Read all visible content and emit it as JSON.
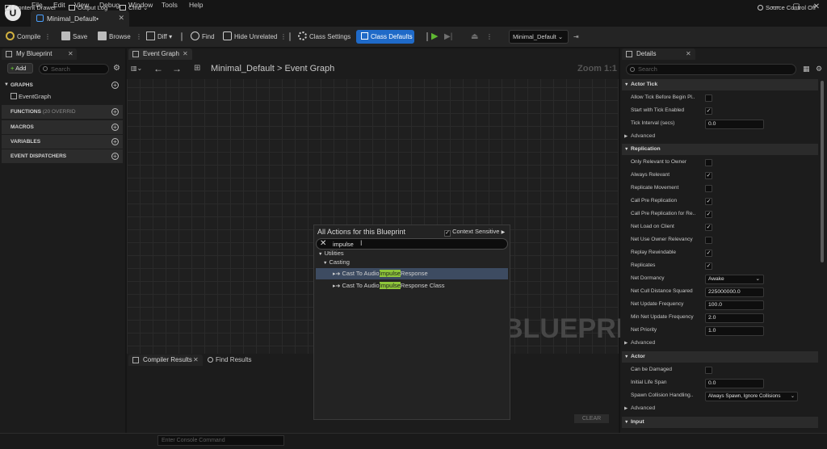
{
  "menu": [
    "File",
    "Edit",
    "View",
    "Debug",
    "Window",
    "Tools",
    "Help"
  ],
  "doc_tab": {
    "label": "Minimal_Default•"
  },
  "toolbar": {
    "compile": "Compile",
    "save": "Save",
    "browse": "Browse",
    "diff": "Diff",
    "find": "Find",
    "hide_unrelated": "Hide Unrelated",
    "class_settings": "Class Settings",
    "class_defaults": "Class Defaults",
    "debug_object": "Minimal_Default"
  },
  "my_blueprint": {
    "tab": "My Blueprint",
    "add": "Add",
    "search_placeholder": "Search",
    "graphs": "GRAPHS",
    "event_graph": "EventGraph",
    "functions": "FUNCTIONS",
    "functions_count": "(20 OVERRID",
    "macros": "MACROS",
    "variables": "VARIABLES",
    "dispatchers": "EVENT DISPATCHERS"
  },
  "graph": {
    "tab": "Event Graph",
    "breadcrumb_root": "Minimal_Default",
    "breadcrumb_sep": ">",
    "breadcrumb_leaf": "Event Graph",
    "zoom": "Zoom 1:1",
    "watermark": "BLUEPRINT"
  },
  "bottom": {
    "compiler_results": "Compiler Results",
    "find_results": "Find Results",
    "clear": "CLEAR"
  },
  "actions_menu": {
    "title": "All Actions for this Blueprint",
    "context_sensitive": "Context Sensitive",
    "query": "impulse",
    "category": "Utilities",
    "subcategory": "Casting",
    "items": [
      {
        "pre": "Cast To Audio",
        "match": "Impulse",
        "post": "Response"
      },
      {
        "pre": "Cast To Audio",
        "match": "Impulse",
        "post": "Response Class"
      }
    ]
  },
  "details": {
    "tab": "Details",
    "search_placeholder": "Search",
    "sections": {
      "actor_tick": "Actor Tick",
      "replication": "Replication",
      "actor": "Actor",
      "input": "Input"
    },
    "advanced": "Advanced",
    "actor_tick": [
      {
        "label": "Allow Tick Before Begin Pl..",
        "checked": false
      },
      {
        "label": "Start with Tick Enabled",
        "checked": true
      },
      {
        "label": "Tick Interval (secs)",
        "value": "0.0"
      }
    ],
    "replication": [
      {
        "label": "Only Relevant to Owner",
        "checked": false
      },
      {
        "label": "Always Relevant",
        "checked": true
      },
      {
        "label": "Replicate Movement",
        "checked": false
      },
      {
        "label": "Call Pre Replication",
        "checked": true
      },
      {
        "label": "Call Pre Replication for Re..",
        "checked": true
      },
      {
        "label": "Net Load on Client",
        "checked": true
      },
      {
        "label": "Net Use Owner Relevancy",
        "checked": false
      },
      {
        "label": "Replay Rewindable",
        "checked": true
      },
      {
        "label": "Replicates",
        "checked": true
      },
      {
        "label": "Net Dormancy",
        "value": "Awake"
      },
      {
        "label": "Net Cull Distance Squared",
        "value": "225000000.0"
      },
      {
        "label": "Net Update Frequency",
        "value": "100.0"
      },
      {
        "label": "Min Net Update Frequency",
        "value": "2.0"
      },
      {
        "label": "Net Priority",
        "value": "1.0"
      }
    ],
    "actor": [
      {
        "label": "Can be Damaged",
        "checked": false
      },
      {
        "label": "Initial Life Span",
        "value": "0.0"
      },
      {
        "label": "Spawn Collision Handling..",
        "value": "Always Spawn, Ignore Collisions"
      }
    ]
  },
  "status": {
    "content_drawer": "Content Drawer",
    "output_log": "Output Log",
    "cmd": "Cmd",
    "console_placeholder": "Enter Console Command",
    "source_control": "Source Control Off"
  },
  "colors": {
    "accent": "#1f6ac8",
    "match_highlight": "#8ec53a",
    "play": "#5fb832"
  }
}
